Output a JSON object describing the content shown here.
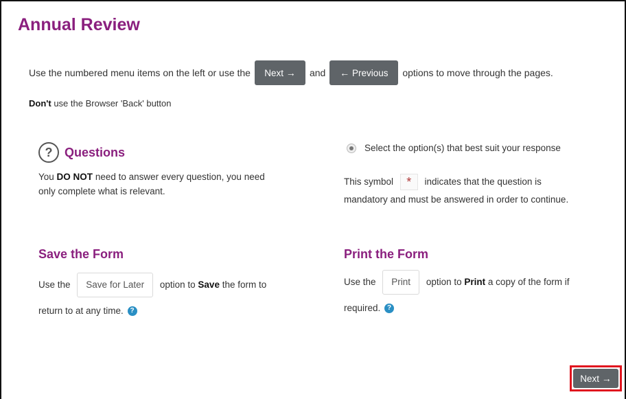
{
  "page": {
    "title": "Annual Review"
  },
  "intro": {
    "text_before": "Use the numbered menu items on the left or use the",
    "next_label": "Next",
    "and": "and",
    "previous_label": "Previous",
    "text_after": "options to move through the pages."
  },
  "warning": {
    "bold": "Don't",
    "rest": "use the Browser 'Back' button"
  },
  "questions": {
    "title": "Questions",
    "before": "You",
    "bold": "DO NOT",
    "line1_rest": "need to answer every question, you need",
    "line2": "only complete what is relevant."
  },
  "select": {
    "text": "Select the option(s) that best suit your response",
    "symbol_before": "This symbol",
    "symbol_after": "indicates that the question is",
    "line2": "mandatory and must be answered in order to continue."
  },
  "save": {
    "title": "Save the Form",
    "use_the": "Use the",
    "button": "Save for Later",
    "option_to": "option to",
    "bold": "Save",
    "rest": "the form to",
    "line2": "return to at any time."
  },
  "print": {
    "title": "Print the Form",
    "use_the": "Use the",
    "button": "Print",
    "option_to": "option to",
    "bold": "Print",
    "rest": "a copy of the form if",
    "line2": "required."
  },
  "footer": {
    "next_label": "Next"
  },
  "colors": {
    "accent": "#8a1f7e",
    "button_dark": "#5f6468",
    "highlight": "#e0141e",
    "help": "#2a8fc4"
  }
}
